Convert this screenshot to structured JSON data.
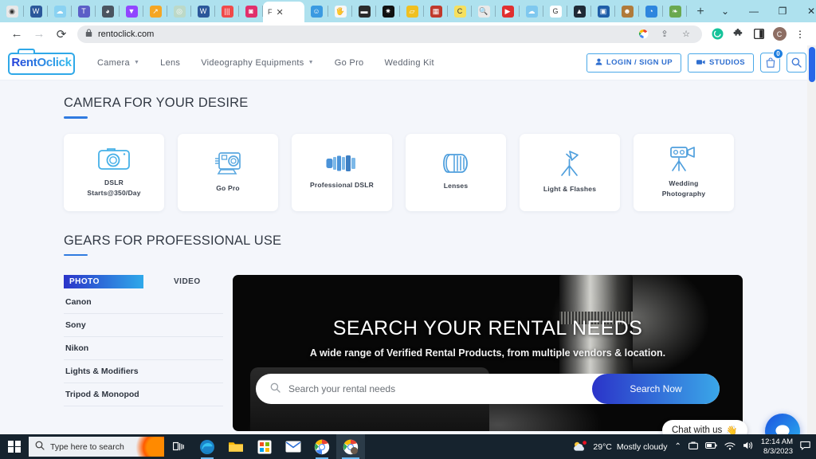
{
  "browser": {
    "tabs": [
      {
        "name": "tab-1",
        "icon": "record-icon",
        "color": "#e8e8e8",
        "glyph": "◉"
      },
      {
        "name": "tab-word-1",
        "icon": "word-icon",
        "color": "#2b579a",
        "glyph": "W"
      },
      {
        "name": "tab-onedrive",
        "icon": "onedrive-icon",
        "color": "#8ad2f2",
        "glyph": "☁"
      },
      {
        "name": "tab-teams",
        "icon": "teams-icon",
        "color": "#5b5fc7",
        "glyph": "T"
      },
      {
        "name": "tab-globe",
        "icon": "globe-icon",
        "color": "#4a5560",
        "glyph": "◕"
      },
      {
        "name": "tab-twitch",
        "icon": "twitch-icon",
        "color": "#9146ff",
        "glyph": "▼"
      },
      {
        "name": "tab-analytics",
        "icon": "analytics-icon",
        "color": "#f5a623",
        "glyph": "↗"
      },
      {
        "name": "tab-circle",
        "icon": "circle-icon",
        "color": "#bcd9c8",
        "glyph": "◎"
      },
      {
        "name": "tab-word-2",
        "icon": "word-icon",
        "color": "#2b579a",
        "glyph": "W"
      },
      {
        "name": "tab-stripes",
        "icon": "stripes-icon",
        "color": "#f04a4a",
        "glyph": "|||"
      },
      {
        "name": "tab-instagram",
        "icon": "instagram-icon",
        "color": "#e1306c",
        "glyph": "◙"
      }
    ],
    "active_tab": {
      "title": "F",
      "close_label": "✕"
    },
    "tabs_after": [
      {
        "name": "tab-facebook",
        "icon": "face-icon",
        "color": "#3b9ae1",
        "glyph": "☺"
      },
      {
        "name": "tab-hand",
        "icon": "hand-icon",
        "color": "#f7f7f7",
        "glyph": "🖐"
      },
      {
        "name": "tab-keyboard",
        "icon": "keyboard-icon",
        "color": "#2b2b2b",
        "glyph": "▬"
      },
      {
        "name": "tab-star",
        "icon": "star-icon",
        "color": "#111111",
        "glyph": "✷"
      },
      {
        "name": "tab-yellow",
        "icon": "note-icon",
        "color": "#f0c020",
        "glyph": "▱"
      },
      {
        "name": "tab-red",
        "icon": "red-icon",
        "color": "#c0392b",
        "glyph": "▦"
      },
      {
        "name": "tab-pacman",
        "icon": "pacman-icon",
        "color": "#f6e05e",
        "glyph": "C"
      },
      {
        "name": "tab-zoom",
        "icon": "magnifier-icon",
        "color": "#e9e9e9",
        "glyph": "🔍"
      },
      {
        "name": "tab-play",
        "icon": "play-icon",
        "color": "#e03030",
        "glyph": "▶"
      },
      {
        "name": "tab-cloud",
        "icon": "cloud-icon",
        "color": "#7fc8ef",
        "glyph": "☁"
      },
      {
        "name": "tab-google",
        "icon": "google-icon",
        "color": "#ffffff",
        "glyph": "G"
      },
      {
        "name": "tab-dark",
        "icon": "tree-icon",
        "color": "#1f2a36",
        "glyph": "▲"
      },
      {
        "name": "tab-camera",
        "icon": "camera-icon",
        "color": "#1f5ea8",
        "glyph": "▣"
      },
      {
        "name": "tab-avatar",
        "icon": "avatar-icon",
        "color": "#b07a3a",
        "glyph": "☻"
      },
      {
        "name": "tab-blue",
        "icon": "blue-icon",
        "color": "#2e86de",
        "glyph": "◔"
      },
      {
        "name": "tab-leaf",
        "icon": "leaf-icon",
        "color": "#6aa84f",
        "glyph": "❧"
      }
    ],
    "new_tab_label": "+",
    "window_controls": {
      "list": "⌄",
      "minimize": "—",
      "maximize": "❐",
      "close": "✕"
    },
    "toolbar": {
      "back": "←",
      "forward": "→",
      "reload": "⟳",
      "lock": "🔒",
      "url": "rentoclick.com",
      "google_lens": "G",
      "share": "⇪",
      "bookmark": "☆",
      "grammarly": "G",
      "extensions": "✦",
      "sidepanel": "▣",
      "profile_initial": "C",
      "menu": "⋮"
    }
  },
  "site": {
    "logo": {
      "text": "RentOclick"
    },
    "nav": [
      {
        "label": "Camera",
        "has_dropdown": true
      },
      {
        "label": "Lens",
        "has_dropdown": false
      },
      {
        "label": "Videography Equipments",
        "has_dropdown": true
      },
      {
        "label": "Go Pro",
        "has_dropdown": false
      },
      {
        "label": "Wedding Kit",
        "has_dropdown": false
      }
    ],
    "actions": {
      "login_label": "LOGIN / SIGN UP",
      "studios_label": "STUDIOS",
      "cart_count": "0"
    },
    "section1": {
      "title": "CAMERA FOR YOUR DESIRE",
      "cards": [
        {
          "icon": "dslr-camera-icon",
          "label": "DSLR\nStarts@350/Day"
        },
        {
          "icon": "gopro-icon",
          "label": "Go Pro"
        },
        {
          "icon": "professional-dslr-icon",
          "label": "Professional DSLR"
        },
        {
          "icon": "lens-icon",
          "label": "Lenses"
        },
        {
          "icon": "light-flash-icon",
          "label": "Light & Flashes"
        },
        {
          "icon": "video-camera-tripod-icon",
          "label": "Wedding\nPhotography"
        }
      ]
    },
    "section2": {
      "title": "GEARS FOR PROFESSIONAL USE",
      "tabs": [
        {
          "label": "PHOTO",
          "active": true
        },
        {
          "label": "VIDEO",
          "active": false
        }
      ],
      "brands": [
        "Canon",
        "Sony",
        "Nikon",
        "Lights & Modifiers",
        "Tripod & Monopod"
      ]
    },
    "hero": {
      "title": "SEARCH YOUR RENTAL NEEDS",
      "subtitle": "A wide range of Verified Rental Products, from multiple vendors & location.",
      "search_placeholder": "Search your rental needs",
      "search_button": "Search Now"
    },
    "chat": {
      "label": "Chat with us",
      "emoji": "👋"
    }
  },
  "taskbar": {
    "search_placeholder": "Type here to search",
    "items": [
      {
        "name": "task-view",
        "glyph": "❏"
      },
      {
        "name": "edge-icon",
        "glyph": "◉"
      },
      {
        "name": "file-explorer-icon",
        "glyph": "🗀"
      },
      {
        "name": "microsoft-store-icon",
        "glyph": "▤"
      },
      {
        "name": "mail-icon",
        "glyph": "✉"
      },
      {
        "name": "chrome-icon",
        "glyph": "◎"
      },
      {
        "name": "chrome-active-icon",
        "glyph": "◎"
      }
    ],
    "weather": {
      "temperature": "29°C",
      "condition": "Mostly cloudy"
    },
    "tray": {
      "chevron": "⌃",
      "onedrive": "☁",
      "battery": "▭",
      "wifi": "◢",
      "volume": "🔊"
    },
    "clock": {
      "time": "12:14 AM",
      "date": "8/3/2023"
    },
    "notifications": "▭"
  },
  "colors": {
    "accent_blue": "#2f7be0",
    "tab_strip": "#aee1ee",
    "page_bg": "#f4f6fb",
    "taskbar": "#16232e"
  }
}
